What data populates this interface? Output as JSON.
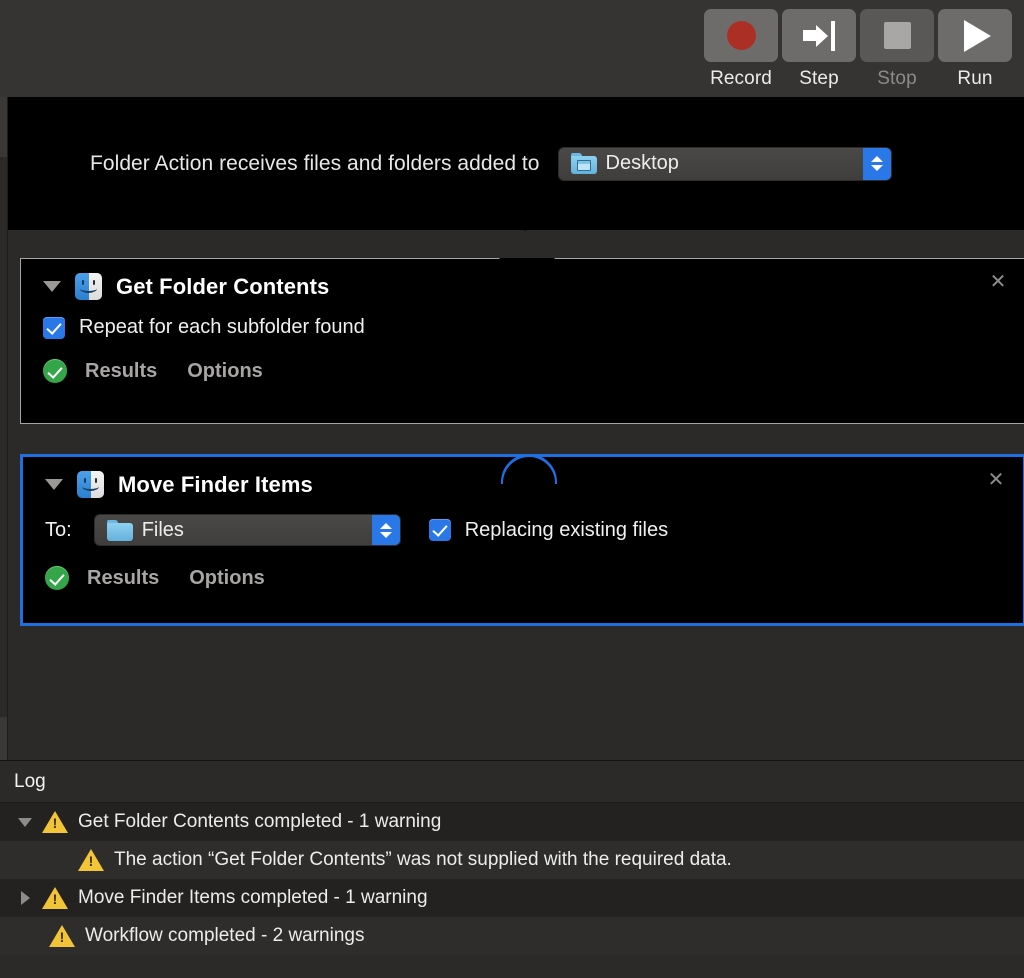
{
  "toolbar": {
    "buttons": [
      {
        "label": "Record",
        "icon": "record-circle-icon",
        "enabled": true
      },
      {
        "label": "Step",
        "icon": "step-forward-icon",
        "enabled": true
      },
      {
        "label": "Stop",
        "icon": "stop-square-icon",
        "enabled": false
      },
      {
        "label": "Run",
        "icon": "run-play-icon",
        "enabled": true
      }
    ]
  },
  "workflow": {
    "header": {
      "text": "Folder Action receives files and folders added to",
      "folder_popup": {
        "value": "Desktop",
        "icon": "desktop-folder-icon",
        "stepper_icon": "up-down-chevron-icon"
      }
    },
    "actions": [
      {
        "title": "Get Folder Contents",
        "app_icon": "finder-icon",
        "disclosure_icon": "disclosure-triangle-open-icon",
        "close_icon": "close-x-icon",
        "selected": false,
        "checkbox": {
          "label": "Repeat for each subfolder found",
          "checked": true
        },
        "status_icon": "green-check-icon",
        "results_label": "Results",
        "options_label": "Options"
      },
      {
        "title": "Move Finder Items",
        "app_icon": "finder-icon",
        "disclosure_icon": "disclosure-triangle-open-icon",
        "close_icon": "close-x-icon",
        "selected": true,
        "to_label": "To:",
        "to_popup": {
          "value": "Files",
          "icon": "blue-folder-icon",
          "stepper_icon": "up-down-chevron-icon"
        },
        "checkbox": {
          "label": "Replacing existing files",
          "checked": true
        },
        "status_icon": "green-check-icon",
        "results_label": "Results",
        "options_label": "Options"
      }
    ]
  },
  "log": {
    "title": "Log",
    "rows": [
      {
        "text": "Get Folder Contents completed - 1 warning",
        "disclosure": "open",
        "icon": "warning-triangle-icon",
        "indent": false
      },
      {
        "text": "The action “Get Folder Contents” was not supplied with the required data.",
        "disclosure": "none",
        "icon": "warning-triangle-icon",
        "indent": true
      },
      {
        "text": "Move Finder Items completed - 1 warning",
        "disclosure": "closed",
        "icon": "warning-triangle-icon",
        "indent": false
      },
      {
        "text": "Workflow completed - 2 warnings",
        "disclosure": "none",
        "icon": "warning-triangle-icon",
        "indent": false
      }
    ]
  },
  "colors": {
    "accent_blue": "#2a77e8",
    "selection_blue": "#1f6fe0",
    "warning_yellow": "#f2c437",
    "success_green": "#35a549",
    "record_red": "#ac2f25",
    "toolbar_bg": "#363432",
    "canvas_bg": "#2b2a28",
    "action_bg": "#000000"
  }
}
